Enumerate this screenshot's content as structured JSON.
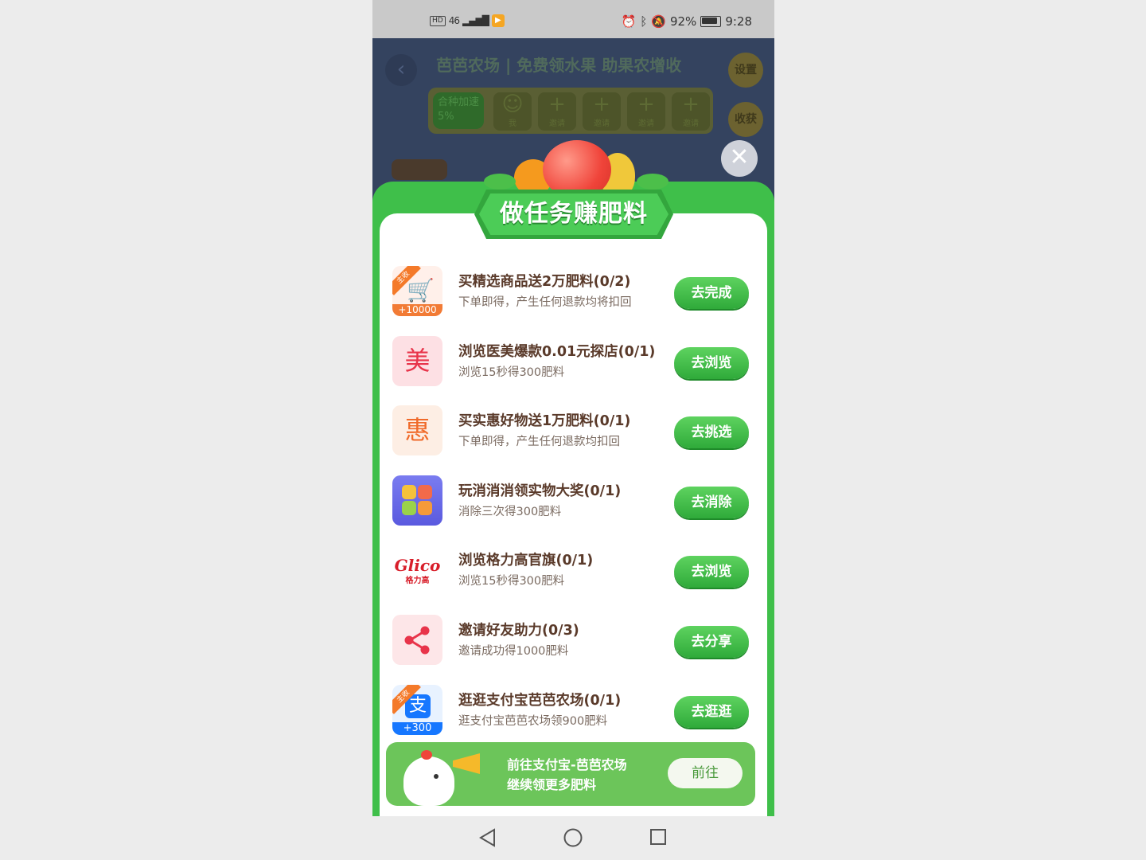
{
  "status_bar": {
    "left_badges": [
      "HD",
      "46"
    ],
    "battery": "92%",
    "time": "9:28"
  },
  "background": {
    "title": "芭芭农场 | 免费领水果 助果农增收",
    "settings_label": "设置",
    "harvest_label": "收获",
    "speed_label": "合种加速5%",
    "me_label": "我",
    "invite_slots": [
      "邀请",
      "邀请",
      "邀请",
      "邀请"
    ]
  },
  "panel": {
    "title": "做任务赚肥料"
  },
  "tasks": [
    {
      "icon": "cart-icon",
      "badge": "主收",
      "reward": "+10000",
      "title": "买精选商品送2万肥料(0/2)",
      "subtitle": "下单即得，产生任何退款均将扣回",
      "button": "去完成"
    },
    {
      "icon": "mei-icon",
      "glyph": "美",
      "title": "浏览医美爆款0.01元探店(0/1)",
      "subtitle": "浏览15秒得300肥料",
      "button": "去浏览"
    },
    {
      "icon": "hui-icon",
      "glyph": "惠",
      "title": "买实惠好物送1万肥料(0/1)",
      "subtitle": "下单即得，产生任何退款均扣回",
      "button": "去挑选"
    },
    {
      "icon": "puzzle-game-icon",
      "title": "玩消消消领实物大奖(0/1)",
      "subtitle": "消除三次得300肥料",
      "button": "去消除"
    },
    {
      "icon": "glico-logo-icon",
      "logo_text": "Glico",
      "logo_sub": "格力高",
      "title": "浏览格力高官旗(0/1)",
      "subtitle": "浏览15秒得300肥料",
      "button": "去浏览"
    },
    {
      "icon": "share-icon",
      "title": "邀请好友助力(0/3)",
      "subtitle": "邀请成功得1000肥料",
      "button": "去分享"
    },
    {
      "icon": "alipay-icon",
      "glyph": "支",
      "badge": "主收",
      "reward": "+300",
      "title": "逛逛支付宝芭芭农场(0/1)",
      "subtitle": "逛支付宝芭芭农场领900肥料",
      "button": "去逛逛"
    }
  ],
  "footer": {
    "line1": "前往支付宝-芭芭农场",
    "line2": "继续领更多肥料",
    "button": "前往"
  },
  "colors": {
    "accent_green": "#3fbf4a",
    "button_green": "#2faa3a",
    "title_brown": "#5a3a2a"
  }
}
